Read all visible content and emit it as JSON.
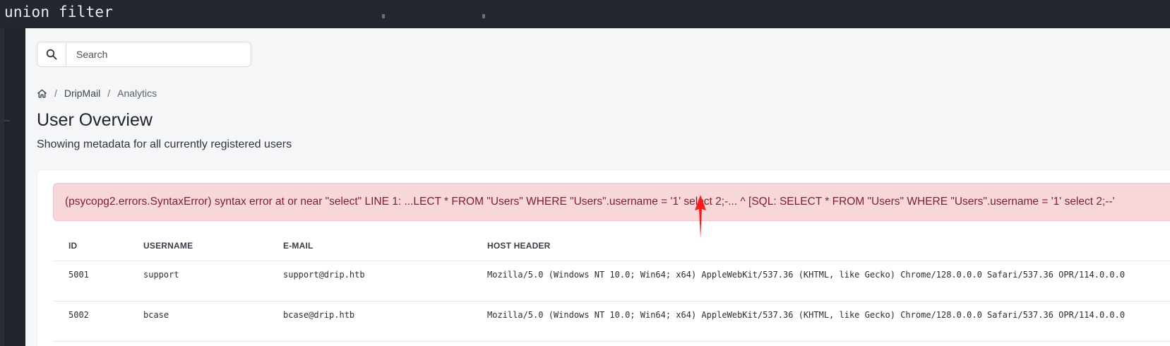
{
  "window": {
    "title": "union filter"
  },
  "search": {
    "placeholder": "Search",
    "icon": "search-icon"
  },
  "breadcrumb": {
    "home_icon": "home-icon",
    "items": [
      "DripMail",
      "Analytics"
    ]
  },
  "page": {
    "title": "User Overview",
    "subtitle": "Showing metadata for all currently registered users"
  },
  "alert": {
    "text": "(psycopg2.errors.SyntaxError) syntax error at or near \"select\" LINE 1: ...LECT * FROM \"Users\" WHERE \"Users\".username = '1' select 2;-... ^ [SQL: SELECT * FROM \"Users\" WHERE \"Users\".username = '1' select 2;--'"
  },
  "table": {
    "headers": [
      "ID",
      "USERNAME",
      "E-MAIL",
      "HOST HEADER"
    ],
    "rows": [
      {
        "id": "5001",
        "username": "support",
        "email": "support@drip.htb",
        "host": "Mozilla/5.0 (Windows NT 10.0; Win64; x64) AppleWebKit/537.36 (KHTML, like Gecko) Chrome/128.0.0.0 Safari/537.36 OPR/114.0.0.0"
      },
      {
        "id": "5002",
        "username": "bcase",
        "email": "bcase@drip.htb",
        "host": "Mozilla/5.0 (Windows NT 10.0; Win64; x64) AppleWebKit/537.36 (KHTML, like Gecko) Chrome/128.0.0.0 Safari/537.36 OPR/114.0.0.0"
      }
    ]
  },
  "annotation": {
    "color": "#ff0000"
  }
}
